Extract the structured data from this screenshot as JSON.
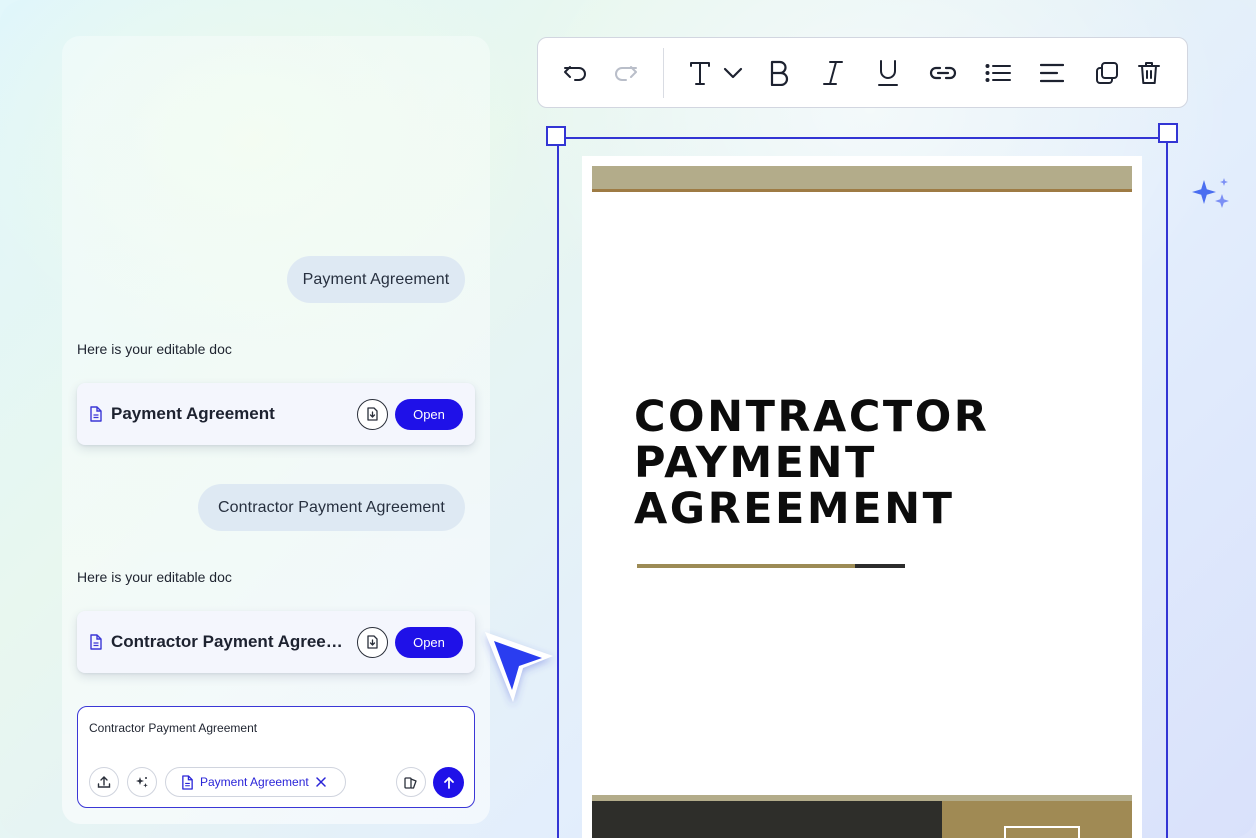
{
  "chat": {
    "messages": [
      {
        "role": "user",
        "text": "Payment Agreement"
      },
      {
        "role": "assistant",
        "text": "Here is your editable doc"
      },
      {
        "role": "user",
        "text": "Contractor Payment Agreement"
      },
      {
        "role": "assistant",
        "text": "Here is your editable doc"
      }
    ],
    "cards": [
      {
        "title": "Payment Agreement",
        "open_label": "Open"
      },
      {
        "title": "Contractor Payment Agreement",
        "open_label": "Open"
      }
    ]
  },
  "composer": {
    "text": "Contractor Payment Agreement",
    "attachment_label": "Payment Agreement"
  },
  "toolbar": {
    "icons": [
      "undo-icon",
      "redo-icon",
      "text-style-icon",
      "chevron-down-icon",
      "bold-icon",
      "italic-icon",
      "underline-icon",
      "link-icon",
      "bullet-list-icon",
      "align-left-icon",
      "duplicate-icon",
      "delete-icon"
    ]
  },
  "document": {
    "heading": "CONTRACTOR\nPAYMENT\nAGREEMENT"
  },
  "colors": {
    "accent": "#1f11e8",
    "selection": "#3335d4",
    "doc_band": "#b3ac8a",
    "doc_gold": "#9c8b55",
    "doc_dark": "#2e2e2a"
  }
}
